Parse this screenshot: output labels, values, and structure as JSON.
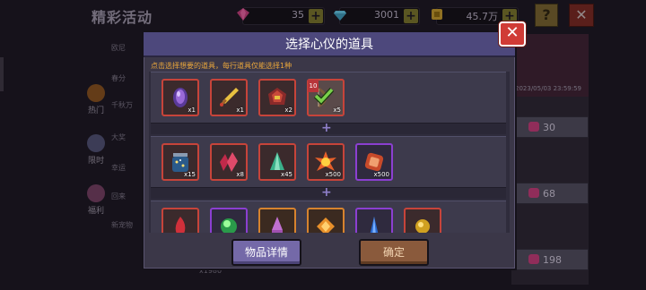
{
  "background": {
    "title": "精彩活动",
    "currencies": [
      {
        "icon": "pink-gem-icon",
        "value": "35",
        "color": "#b03a72"
      },
      {
        "icon": "blue-diamond-icon",
        "value": "3001",
        "color": "#3a8aa8"
      },
      {
        "icon": "gold-coin-icon",
        "value": "45.7万",
        "color": "#b08a2a"
      }
    ],
    "nav": [
      {
        "label": "热门",
        "icon": "fire-icon"
      },
      {
        "label": "限时",
        "icon": "clock-icon"
      },
      {
        "label": "福利",
        "icon": "gift-icon"
      }
    ],
    "side_list": [
      "欧尼",
      "春分",
      "千秋万",
      "大奖",
      "幸运",
      "回来",
      "新宠物"
    ],
    "right_panel": {
      "date": "2023/05/03 23:59:59",
      "costs": [
        "30",
        "68",
        "198"
      ]
    },
    "bottom_text": "x1980"
  },
  "modal": {
    "title": "选择心仪的道具",
    "instruction": "点击选择想要的道具，每行道具仅能选择1种",
    "close_symbol": "✕",
    "separator_symbol": "+",
    "rows": [
      [
        {
          "icon": "purple-crystal-icon",
          "count": "x1",
          "frame": "rare"
        },
        {
          "icon": "golden-sword-icon",
          "count": "x1",
          "frame": "rare"
        },
        {
          "icon": "red-helmet-icon",
          "count": "x2",
          "frame": "rare"
        },
        {
          "icon": "bow-item-icon",
          "count": "x5",
          "frame": "rare",
          "selected": true,
          "badge": "10"
        }
      ],
      [
        {
          "icon": "star-jar-icon",
          "count": "x15",
          "frame": "rare"
        },
        {
          "icon": "red-crystal-icon",
          "count": "x8",
          "frame": "rare"
        },
        {
          "icon": "green-cone-icon",
          "count": "x45",
          "frame": "rare"
        },
        {
          "icon": "fire-burst-icon",
          "count": "x500",
          "frame": "rare"
        },
        {
          "icon": "orange-rune-icon",
          "count": "x500",
          "frame": "epic"
        }
      ],
      [
        {
          "icon": "red-flame-icon",
          "count": "",
          "frame": "rare"
        },
        {
          "icon": "green-orb-icon",
          "count": "",
          "frame": "epic"
        },
        {
          "icon": "pink-potion-icon",
          "count": "",
          "frame": "orange"
        },
        {
          "icon": "amber-gem-icon",
          "count": "",
          "frame": "orange"
        },
        {
          "icon": "blue-shard-icon",
          "count": "",
          "frame": "epic"
        },
        {
          "icon": "gold-nugget-icon",
          "count": "",
          "frame": "rare"
        }
      ]
    ],
    "buttons": {
      "detail": "物品详情",
      "confirm": "确定"
    }
  }
}
